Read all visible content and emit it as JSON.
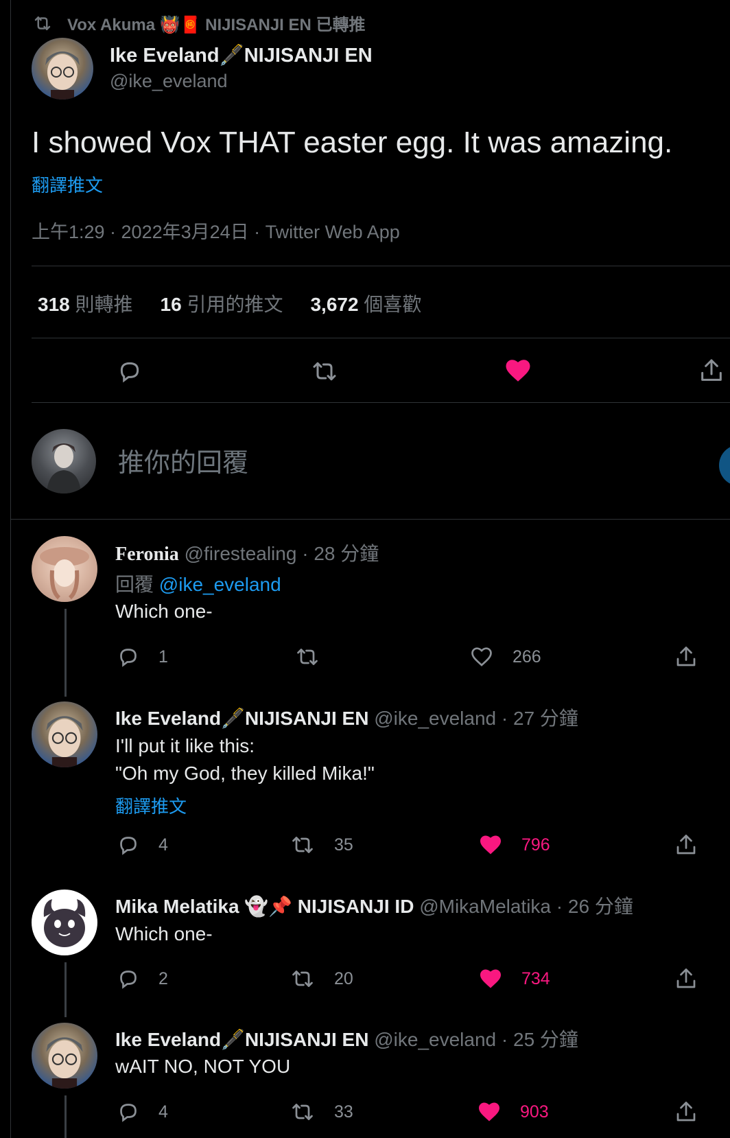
{
  "retweet_banner": {
    "text": "Vox Akuma 👹🧧 NIJISANJI EN 已轉推",
    "icon": "retweet-icon"
  },
  "main_tweet": {
    "author_name": "Ike Eveland🖋️NIJISANJI EN",
    "handle": "@ike_eveland",
    "text": "I showed Vox THAT easter egg. It was amazing.",
    "translate": "翻譯推文",
    "meta": "上午1:29 · 2022年3月24日 · Twitter Web App",
    "stats": {
      "retweets_count": "318",
      "retweets_label": "則轉推",
      "quotes_count": "16",
      "quotes_label": "引用的推文",
      "likes_count": "3,672",
      "likes_label": "個喜歡"
    },
    "actions": {
      "reply": "reply-icon",
      "retweet": "retweet-icon",
      "like": "heart-filled-icon",
      "share": "share-icon"
    }
  },
  "reply_box": {
    "placeholder": "推你的回覆"
  },
  "replies": [
    {
      "name": "Feronia",
      "handle": "@firestealing",
      "time": "· 28 分鐘",
      "reply_to_label": "回覆",
      "reply_to_handle": "@ike_eveland",
      "text": "Which one-",
      "reply_count": "1",
      "retweet_count": "",
      "like_count": "266",
      "liked": false
    },
    {
      "name": "Ike Eveland🖋️NIJISANJI EN",
      "handle": "@ike_eveland",
      "time": "· 27 分鐘",
      "text_line1": "I'll put it like this:",
      "text_line2": "\"Oh my God, they killed Mika!\"",
      "translate": "翻譯推文",
      "reply_count": "4",
      "retweet_count": "35",
      "like_count": "796",
      "liked": true
    },
    {
      "name": "Mika Melatika 👻📌 NIJISANJI ID",
      "handle": "@MikaMelatika",
      "time": "· 26 分鐘",
      "text": "Which one-",
      "reply_count": "2",
      "retweet_count": "20",
      "like_count": "734",
      "liked": true
    },
    {
      "name": "Ike Eveland🖋️NIJISANJI EN",
      "handle": "@ike_eveland",
      "time": "· 25 分鐘",
      "text": "wAIT NO, NOT YOU",
      "reply_count": "4",
      "retweet_count": "33",
      "like_count": "903",
      "liked": true
    }
  ],
  "colors": {
    "accent": "#1d9bf0",
    "like": "#f91880",
    "muted": "#71767b",
    "background": "#000000"
  }
}
